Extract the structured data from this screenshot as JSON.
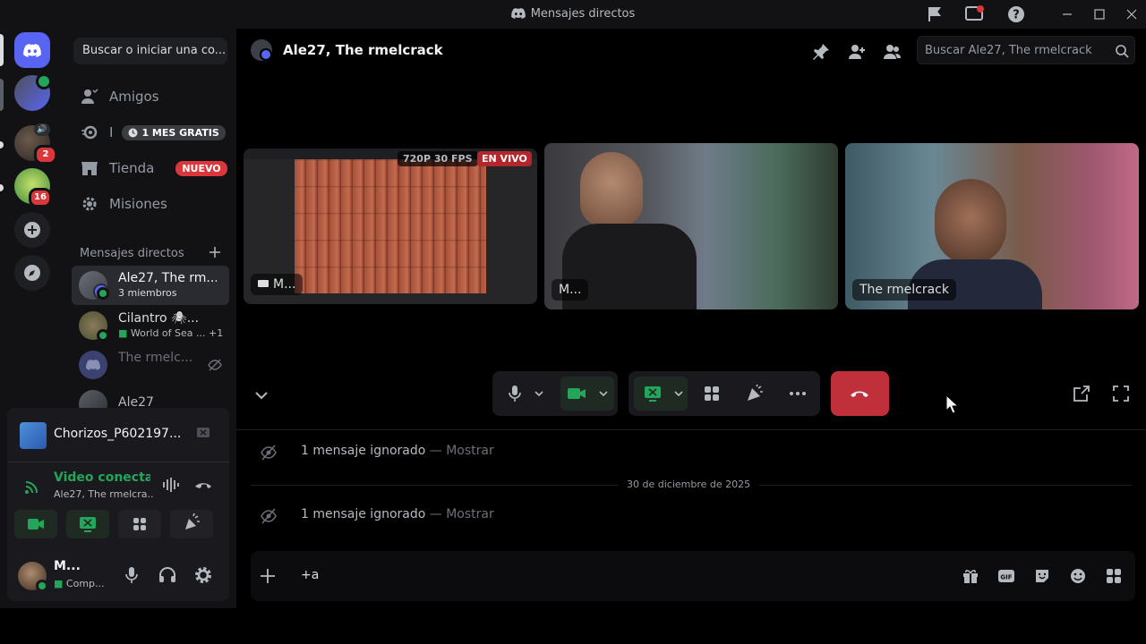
{
  "window": {
    "title": "Mensajes directos"
  },
  "servers": {
    "badge_1": "2",
    "badge_2": "16"
  },
  "sidebar": {
    "search_label": "Buscar o iniciar una co...",
    "nav": [
      {
        "label": "Amigos",
        "icon": "friends-icon"
      },
      {
        "label": "I",
        "icon": "nitro-icon",
        "badge": "1 MES GRATIS"
      },
      {
        "label": "Tienda",
        "icon": "shop-icon",
        "badge": "NUEVO"
      },
      {
        "label": "Misiones",
        "icon": "quests-icon"
      }
    ],
    "dm_header": "Mensajes directos",
    "dms": [
      {
        "name": "Ale27, The rm...",
        "sub": "3 miembros"
      },
      {
        "name": "Cilantro 🕷...",
        "sub": "World of Sea ... +1"
      },
      {
        "name": "The rmelc..."
      },
      {
        "name": "Ale27"
      }
    ]
  },
  "voice": {
    "stream_title": "Chorizos_P602197...",
    "status": "Video conectad",
    "channel": "Ale27, The rmelcra..."
  },
  "user": {
    "name": "M...",
    "status": "Comp..."
  },
  "header": {
    "channel_name": "Ale27, The rmelcrack",
    "search_placeholder": "Buscar Ale27, The rmelcrack"
  },
  "call": {
    "tiles": [
      {
        "label": "M...",
        "quality": "720P 30 FPS",
        "live": "EN VIVO"
      },
      {
        "label": "M..."
      },
      {
        "label": "The rmelcrack"
      }
    ]
  },
  "chat": {
    "messages": [
      {
        "text": "1 mensaje ignorado",
        "sep": " — ",
        "action": "Mostrar"
      },
      {
        "text": "1 mensaje ignorado",
        "sep": " — ",
        "action": "Mostrar"
      }
    ],
    "date_divider": "30 de diciembre de 2025",
    "composer_value": "+a"
  },
  "colors": {
    "accent": "#5865f2",
    "green": "#23a55a",
    "danger": "#da373c",
    "hangup": "#c0303b"
  }
}
